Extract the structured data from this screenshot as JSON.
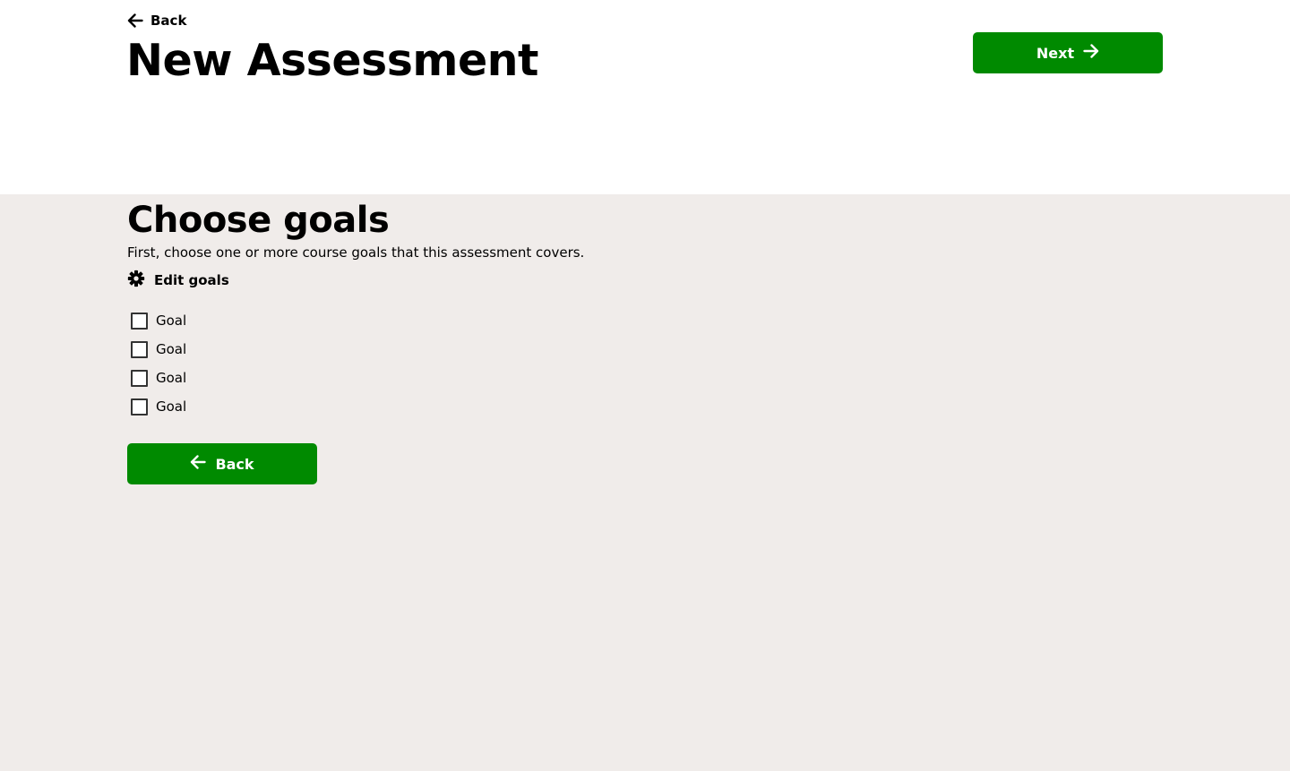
{
  "header": {
    "back_label": "Back",
    "title": "New Assessment",
    "next_label": "Next"
  },
  "section": {
    "title": "Choose goals",
    "description": "First, choose one or more course goals that this assessment covers.",
    "edit_goals_label": "Edit goals"
  },
  "goals": [
    {
      "label": "Goal",
      "checked": false
    },
    {
      "label": "Goal",
      "checked": false
    },
    {
      "label": "Goal",
      "checked": false
    },
    {
      "label": "Goal",
      "checked": false
    }
  ],
  "footer": {
    "back_label": "Back"
  },
  "colors": {
    "accent": "#008a00",
    "header_bg": "#ffffff",
    "page_bg": "#f0ecea",
    "text": "#000000"
  },
  "icons": {
    "back": "arrow-left-icon",
    "next": "arrow-right-icon",
    "edit": "gear-icon"
  }
}
